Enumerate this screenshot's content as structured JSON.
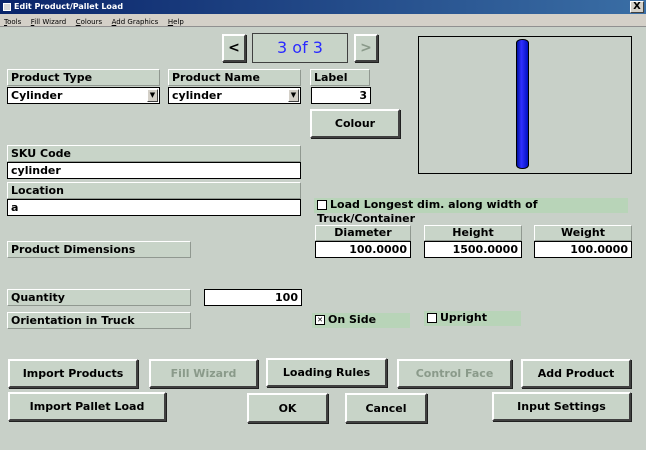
{
  "window": {
    "title": "Edit Product/Pallet Load",
    "close": "X"
  },
  "menu": [
    {
      "u": "T",
      "rest": "ools"
    },
    {
      "u": "F",
      "rest": "ill Wizard"
    },
    {
      "u": "C",
      "rest": "olours"
    },
    {
      "u": "A",
      "rest": "dd Graphics"
    },
    {
      "u": "H",
      "rest": "elp"
    }
  ],
  "nav": {
    "prev": "<",
    "counter": "3 of 3",
    "next": ">"
  },
  "product_type": {
    "label": "Product Type",
    "value": "Cylinder"
  },
  "product_name": {
    "label": "Product Name",
    "value": "cylinder"
  },
  "label_field": {
    "label": "Label",
    "value": "3"
  },
  "colour_button": "Colour",
  "sku": {
    "label": "SKU Code",
    "value": "cylinder"
  },
  "location": {
    "label": "Location",
    "value": "a"
  },
  "load_longest": {
    "label": "Load Longest dim. along width of Truck/Container",
    "checked": false
  },
  "dimensions": {
    "label": "Product Dimensions",
    "diameter_label": "Diameter",
    "diameter": "100.0000",
    "height_label": "Height",
    "height": "1500.0000",
    "weight_label": "Weight",
    "weight": "100.0000"
  },
  "quantity": {
    "label": "Quantity",
    "value": "100"
  },
  "orientation": {
    "label": "Orientation in Truck",
    "on_side": "On Side",
    "on_side_checked": true,
    "upright": "Upright",
    "upright_checked": false
  },
  "buttons": {
    "import_products": "Import Products",
    "fill_wizard": "Fill Wizard",
    "loading_rules": "Loading Rules",
    "control_face": "Control Face",
    "add_product": "Add Product",
    "import_pallet": "Import Pallet Load",
    "ok": "OK",
    "cancel": "Cancel",
    "input_settings": "Input Settings"
  },
  "colors": {
    "title_start": "#0a246a",
    "cylinder": "#1a1aff",
    "counter_text": "#2a2aff"
  }
}
